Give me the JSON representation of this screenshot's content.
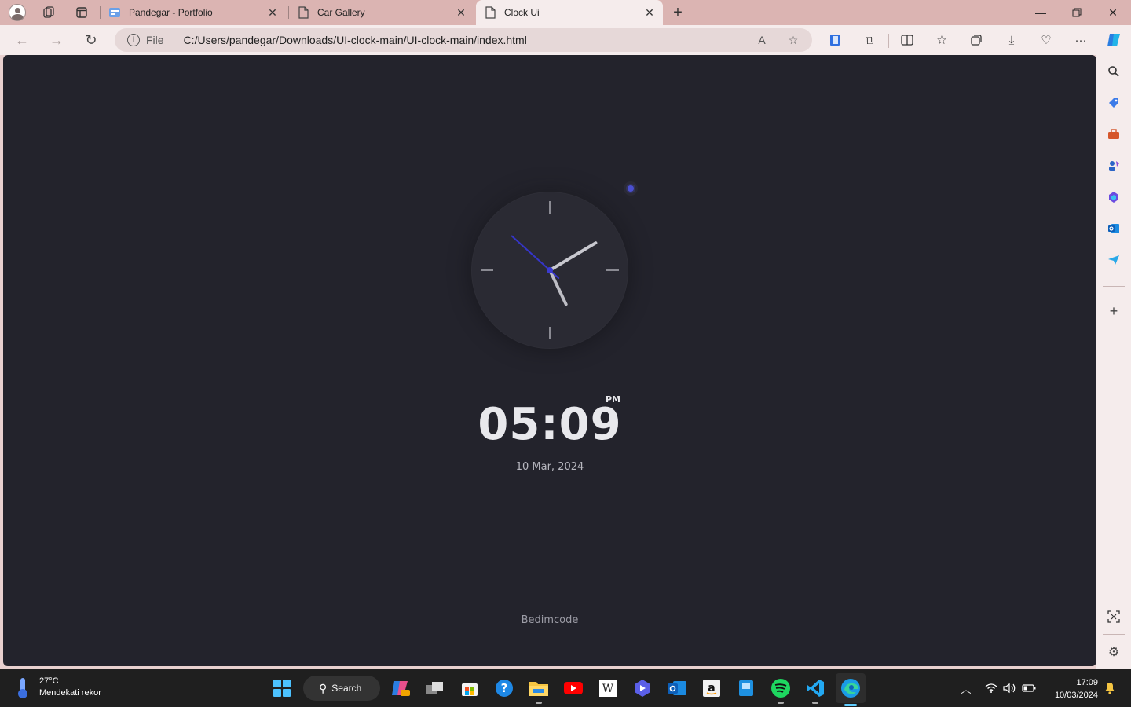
{
  "browser": {
    "tabs": [
      {
        "title": "Pandegar - Portfolio",
        "active": false
      },
      {
        "title": "Car Gallery",
        "active": false
      },
      {
        "title": "Clock Ui",
        "active": true
      }
    ],
    "address": {
      "scheme_label": "File",
      "url": "C:/Users/pandegar/Downloads/UI-clock-main/UI-clock-main/index.html"
    }
  },
  "page": {
    "time": "05:09",
    "meridiem": "PM",
    "date": "10 Mar, 2024",
    "credit": "Bedimcode",
    "clock": {
      "hour": 5,
      "minute": 9,
      "second": 52
    },
    "accent_color": "#3b3bd0",
    "background_color": "#23232c"
  },
  "taskbar": {
    "weather": {
      "temp": "27°C",
      "condition": "Mendekati rekor"
    },
    "search_label": "Search",
    "clock": {
      "time": "17:09",
      "date": "10/03/2024"
    }
  }
}
